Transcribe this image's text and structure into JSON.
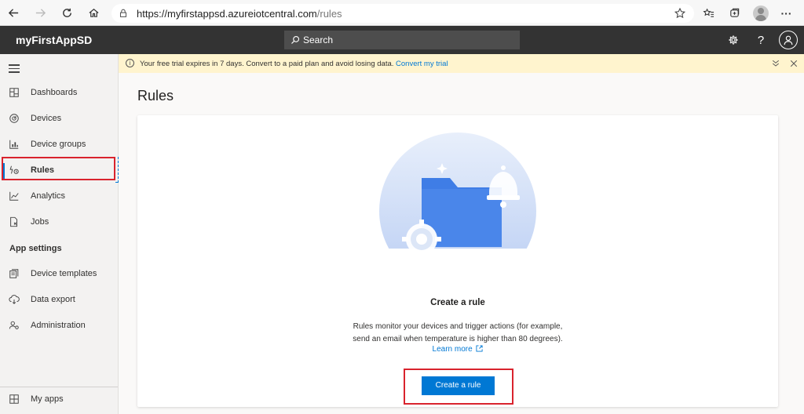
{
  "browser": {
    "url_host": "https://myfirstappsd.azureiotcentral.com",
    "url_path": "/rules"
  },
  "header": {
    "app_title": "myFirstAppSD",
    "search_placeholder": "Search"
  },
  "banner": {
    "message": "Your free trial expires in 7 days. Convert to a paid plan and avoid losing data.",
    "link": "Convert my trial"
  },
  "sidebar": {
    "items": [
      {
        "label": "Dashboards",
        "icon": "dashboard-icon"
      },
      {
        "label": "Devices",
        "icon": "devices-icon"
      },
      {
        "label": "Device groups",
        "icon": "device-groups-icon"
      },
      {
        "label": "Rules",
        "icon": "rules-icon",
        "active": true
      },
      {
        "label": "Analytics",
        "icon": "analytics-icon"
      },
      {
        "label": "Jobs",
        "icon": "jobs-icon"
      }
    ],
    "section_title": "App settings",
    "settings_items": [
      {
        "label": "Device templates",
        "icon": "device-templates-icon"
      },
      {
        "label": "Data export",
        "icon": "data-export-icon"
      },
      {
        "label": "Administration",
        "icon": "administration-icon"
      }
    ],
    "footer_item": {
      "label": "My apps",
      "icon": "my-apps-icon"
    }
  },
  "main": {
    "title": "Rules",
    "empty_title": "Create a rule",
    "empty_desc_line1": "Rules monitor your devices and trigger actions (for example,",
    "empty_desc_line2": "send an email when temperature is higher than 80 degrees).",
    "learn_more": "Learn more",
    "cta": "Create a rule"
  },
  "colors": {
    "accent": "#0078d4",
    "header_bg": "#333333",
    "banner_bg": "#fff4ce",
    "highlight": "#d9232d"
  }
}
